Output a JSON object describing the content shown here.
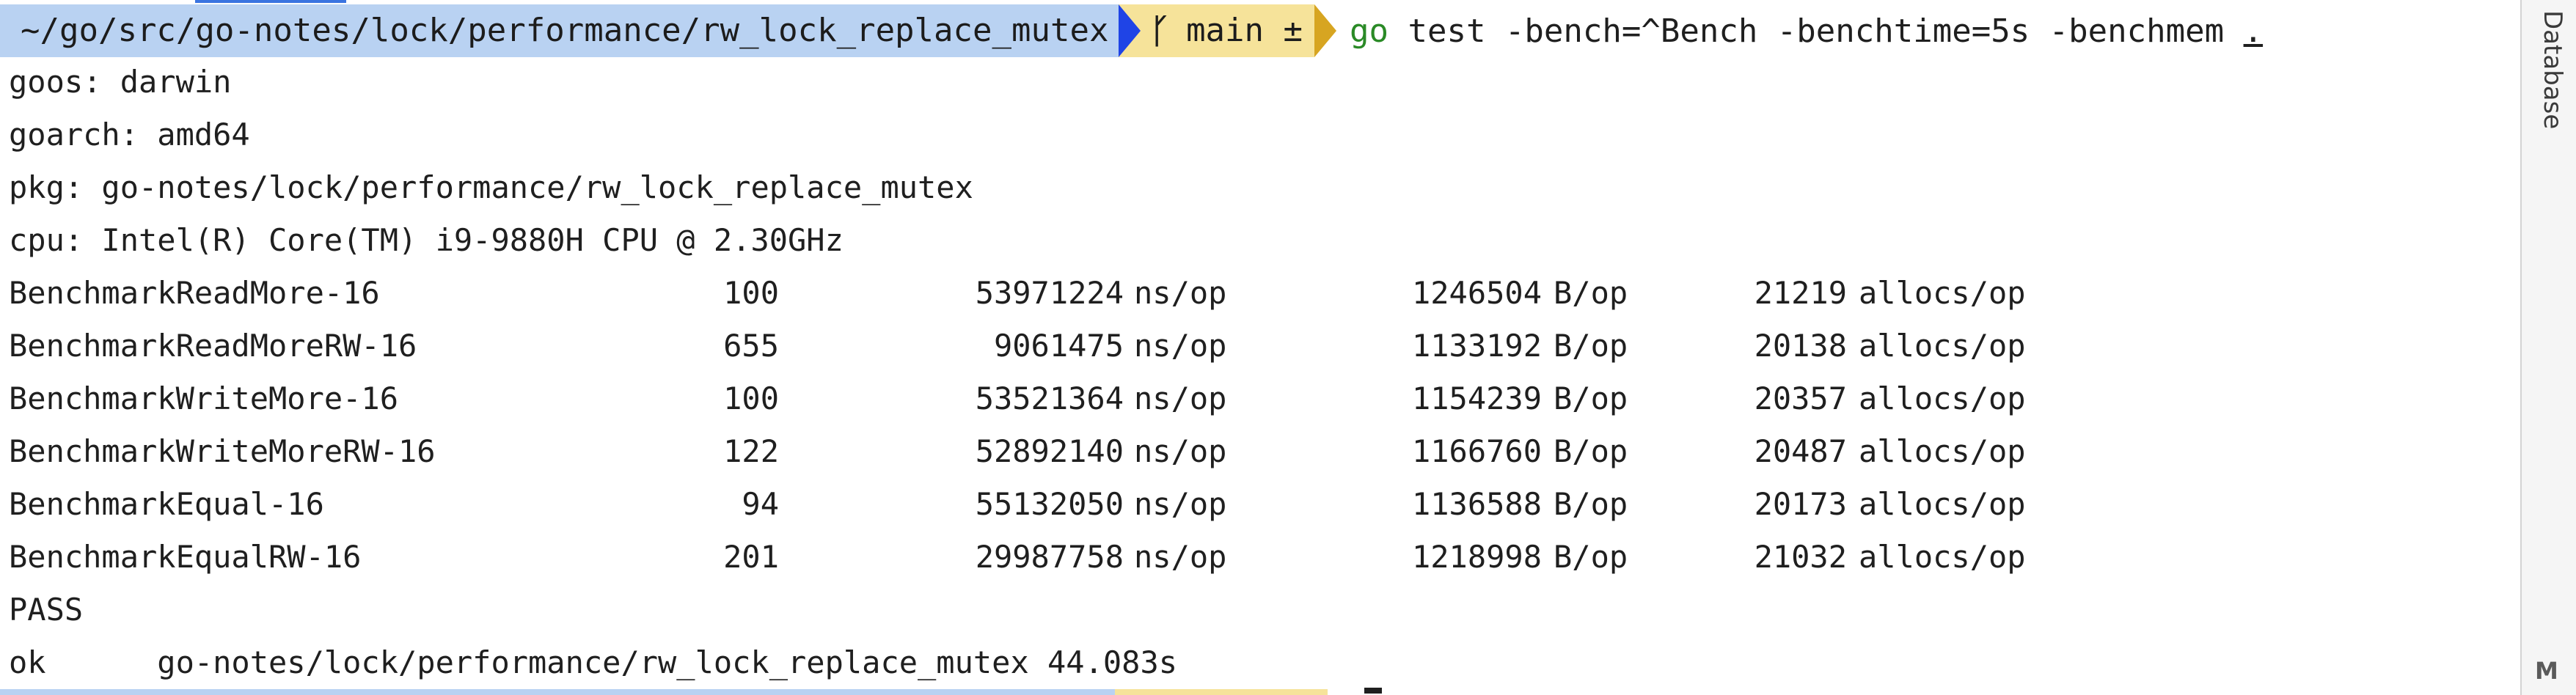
{
  "prompt": {
    "path": "~/go/src/go-notes/lock/performance/rw_lock_replace_mutex",
    "branch_icon": "git-branch-icon",
    "branch": "main ±",
    "cmd_go": "go",
    "cmd_rest": " test -bench=^Bench -benchtime=5s -benchmem ",
    "cmd_dot": "."
  },
  "env": {
    "goos": "goos: darwin",
    "goarch": "goarch: amd64",
    "pkg": "pkg: go-notes/lock/performance/rw_lock_replace_mutex",
    "cpu": "cpu: Intel(R) Core(TM) i9-9880H CPU @ 2.30GHz"
  },
  "benchmarks": [
    {
      "name": "BenchmarkReadMore-16",
      "n": "100",
      "ns": "53971224",
      "ns_unit": "ns/op",
      "b": "1246504",
      "b_unit": "B/op",
      "allocs": "21219",
      "allocs_unit": "allocs/op"
    },
    {
      "name": "BenchmarkReadMoreRW-16",
      "n": "655",
      "ns": "9061475",
      "ns_unit": "ns/op",
      "b": "1133192",
      "b_unit": "B/op",
      "allocs": "20138",
      "allocs_unit": "allocs/op"
    },
    {
      "name": "BenchmarkWriteMore-16",
      "n": "100",
      "ns": "53521364",
      "ns_unit": "ns/op",
      "b": "1154239",
      "b_unit": "B/op",
      "allocs": "20357",
      "allocs_unit": "allocs/op"
    },
    {
      "name": "BenchmarkWriteMoreRW-16",
      "n": "122",
      "ns": "52892140",
      "ns_unit": "ns/op",
      "b": "1166760",
      "b_unit": "B/op",
      "allocs": "20487",
      "allocs_unit": "allocs/op"
    },
    {
      "name": "BenchmarkEqual-16",
      "n": "94",
      "ns": "55132050",
      "ns_unit": "ns/op",
      "b": "1136588",
      "b_unit": "B/op",
      "allocs": "20173",
      "allocs_unit": "allocs/op"
    },
    {
      "name": "BenchmarkEqualRW-16",
      "n": "201",
      "ns": "29987758",
      "ns_unit": "ns/op",
      "b": "1218998",
      "b_unit": "B/op",
      "allocs": "21032",
      "allocs_unit": "allocs/op"
    }
  ],
  "result": {
    "pass": "PASS",
    "ok": "ok      go-notes/lock/performance/rw_lock_replace_mutex 44.083s"
  },
  "side_panel": {
    "tab_label": "Database",
    "bottom_icon": "M"
  },
  "colors": {
    "path_bg": "#b9d2f2",
    "branch_bg": "#f6e39a",
    "arrow_blue": "#1f44e6",
    "arrow_gold": "#d7a521",
    "go_green": "#2a8a26"
  }
}
